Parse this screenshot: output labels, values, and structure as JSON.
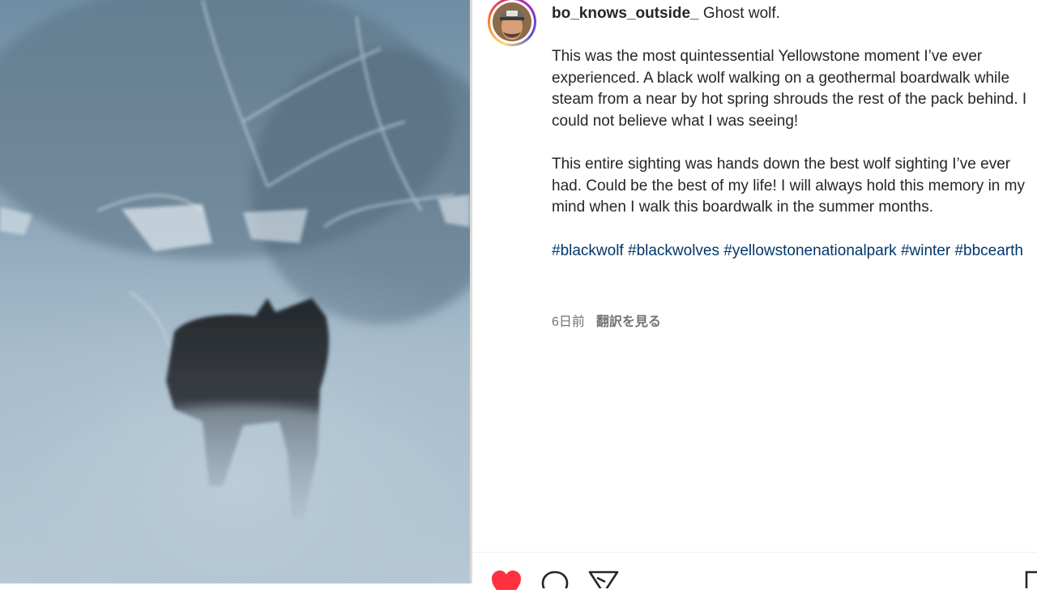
{
  "post": {
    "username": "bo_knows_outside_",
    "title": "Ghost wolf.",
    "paragraphs": [
      "This was the most quintessential Yellowstone moment I’ve ever experienced. A black wolf walking on a geothermal boardwalk while steam from a near by hot spring shrouds the rest of the pack behind. I could not believe what I was seeing!",
      "This entire sighting was hands down the best wolf sighting I’ve ever had. Could be the best of my life! I will always hold this memory in my mind when I walk this boardwalk in the summer months."
    ],
    "hashtags": [
      "#blackwolf",
      "#blackwolves",
      "#yellowstonenationalpark",
      "#winter",
      "#bbcearth"
    ],
    "timestamp": "6日前",
    "translate_label": "翻訳を見る"
  },
  "media": {
    "subject": "black wolf in steam on snowy boardwalk"
  },
  "actions": {
    "like": "heart-icon",
    "comment": "comment-icon",
    "share": "send-icon",
    "save": "bookmark-icon",
    "like_color": "#ff3040"
  }
}
